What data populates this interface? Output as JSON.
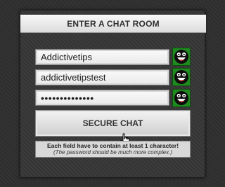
{
  "dialog": {
    "title": "ENTER A CHAT ROOM"
  },
  "fields": [
    {
      "name": "room",
      "value": "Addictivetips",
      "type": "text",
      "status_icon": "happy-face-icon",
      "status_color": "#1f8a1f"
    },
    {
      "name": "nickname",
      "value": "addictivetipstest",
      "type": "text",
      "status_icon": "happy-face-icon",
      "status_color": "#1f8a1f"
    },
    {
      "name": "password",
      "value": "••••••••••••••",
      "type": "password",
      "status_icon": "happy-face-icon",
      "status_color": "#1f8a1f"
    }
  ],
  "button": {
    "label": "SECURE CHAT"
  },
  "note": {
    "line1": "Each field have to contain at least 1 character!",
    "line2": "(The password should be much more complex.)"
  },
  "colors": {
    "background": "#2d2d2d",
    "panel": "#343434",
    "status_ok": "#1f8a1f"
  }
}
